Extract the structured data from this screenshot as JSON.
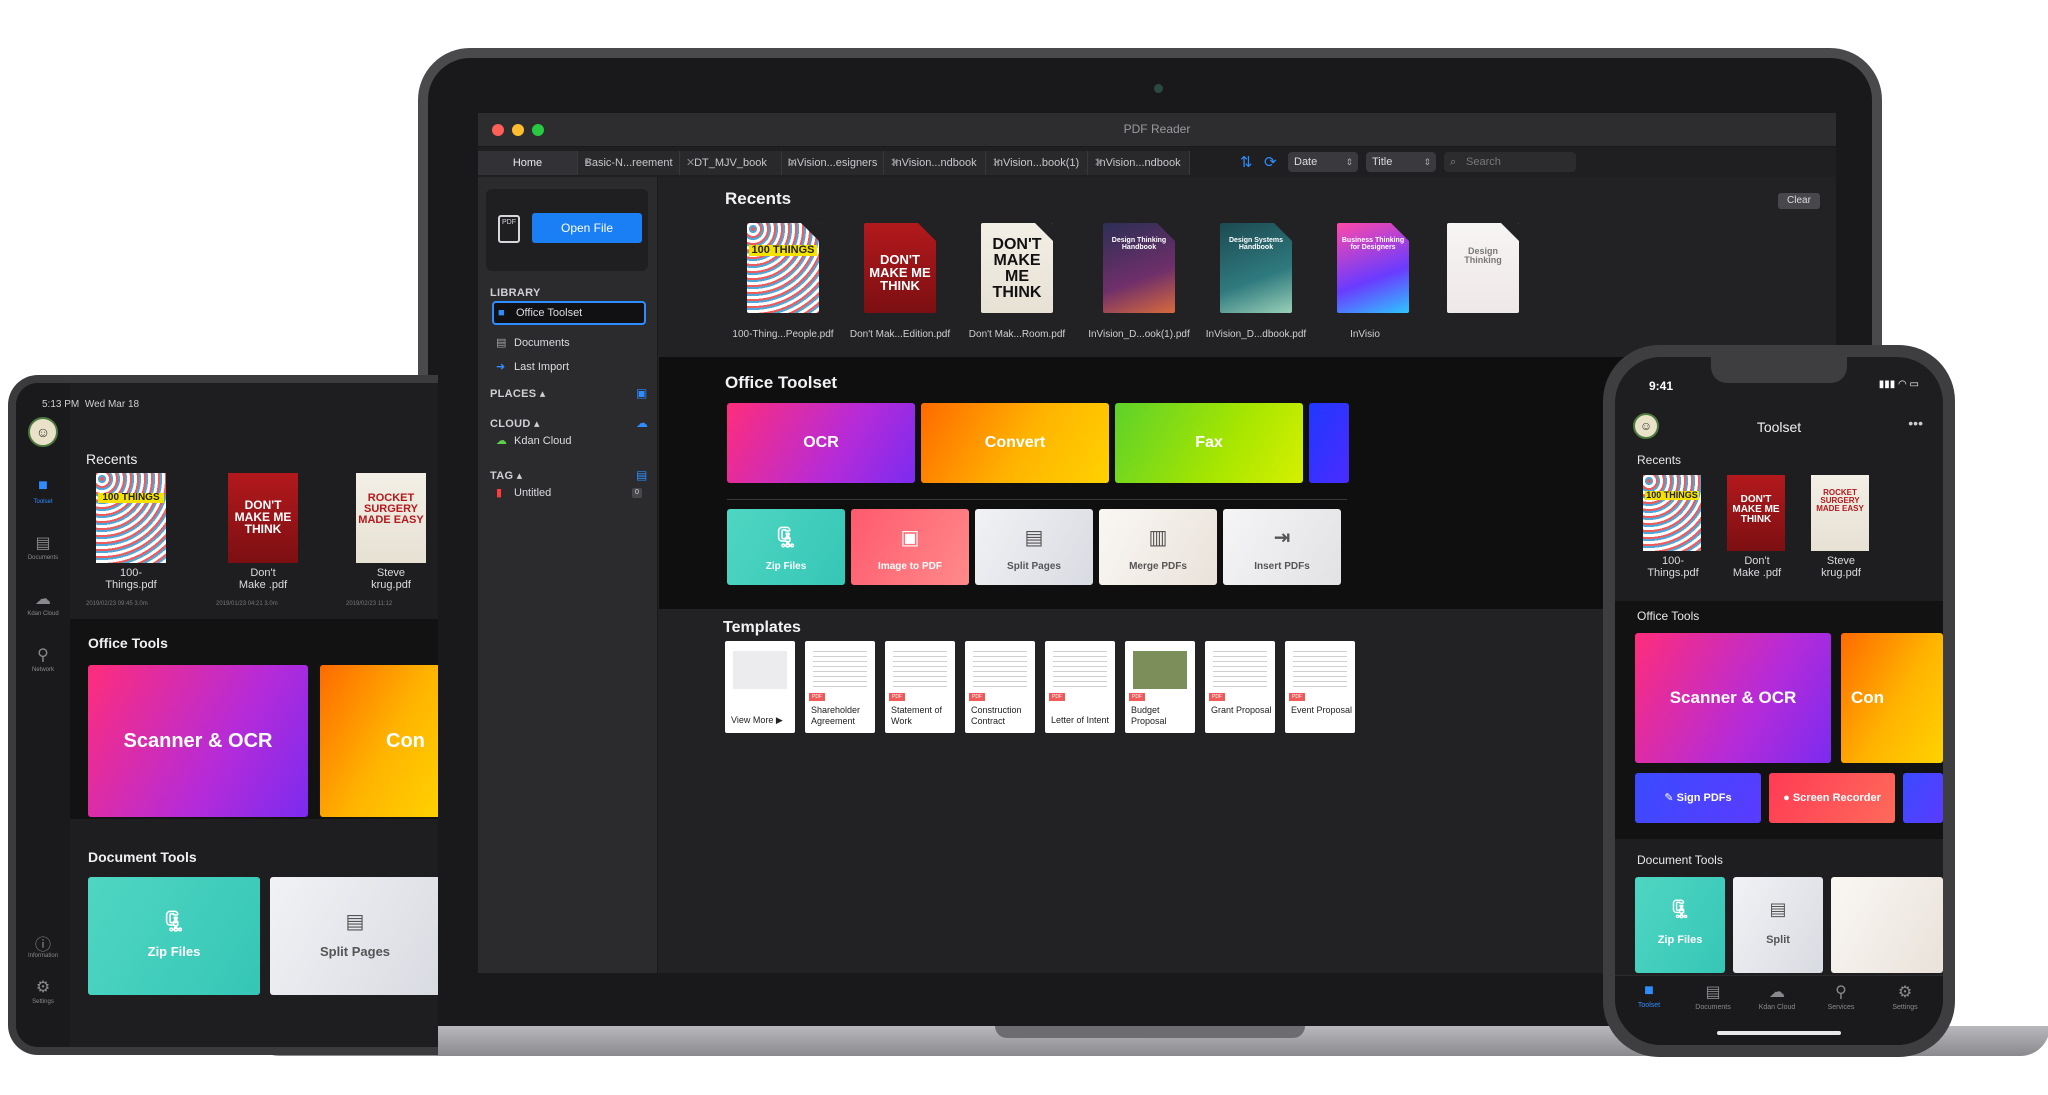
{
  "laptop": {
    "window_title": "PDF Reader",
    "tabs": [
      {
        "label": "Home"
      },
      {
        "label": "Basic-N...reement"
      },
      {
        "label": "DT_MJV_book"
      },
      {
        "label": "InVision...esigners"
      },
      {
        "label": "InVision...ndbook"
      },
      {
        "label": "InVision...book(1)"
      },
      {
        "label": "InVision...ndbook"
      }
    ],
    "toolbar": {
      "sort_select": "Date",
      "sort_select2": "Title",
      "search_placeholder": "Search"
    },
    "sidebar": {
      "open_button": "Open File",
      "library_title": "LIBRARY",
      "library_items": [
        {
          "label": "Office Toolset"
        },
        {
          "label": "Documents"
        },
        {
          "label": "Last Import"
        }
      ],
      "places_title": "PLACES",
      "cloud_title": "CLOUD",
      "cloud_items": [
        {
          "label": "Kdan Cloud"
        }
      ],
      "tag_title": "TAG",
      "tag_items": [
        {
          "label": "Untitled",
          "count": "0"
        }
      ]
    },
    "recents": {
      "title": "Recents",
      "clear_button": "Clear",
      "files": [
        {
          "label": "100-Thing...People.pdf",
          "cover": "100 THINGS"
        },
        {
          "label": "Don't Mak...Edition.pdf",
          "cover": "DON'T MAKE ME THINK"
        },
        {
          "label": "Don't Mak...Room.pdf",
          "cover": "DON'T MAKE ME THINK"
        },
        {
          "label": "InVision_D...ook(1).pdf",
          "cover": "Design Thinking Handbook"
        },
        {
          "label": "InVision_D...dbook.pdf",
          "cover": "Design Systems Handbook"
        },
        {
          "label": "InVisio",
          "cover": "Business Thinking for Designers"
        },
        {
          "label": "",
          "cover": "Design Thinking"
        }
      ]
    },
    "office_toolset": {
      "title": "Office Toolset",
      "big_tools": [
        {
          "label": "OCR"
        },
        {
          "label": "Convert"
        },
        {
          "label": "Fax"
        }
      ],
      "small_tools": [
        {
          "label": "Zip Files"
        },
        {
          "label": "Image to PDF"
        },
        {
          "label": "Split Pages"
        },
        {
          "label": "Merge PDFs"
        },
        {
          "label": "Insert PDFs"
        }
      ]
    },
    "templates": {
      "title": "Templates",
      "items": [
        {
          "label": "View More ▶",
          "badge": ""
        },
        {
          "label": "Shareholder Agreement",
          "badge": "PDF"
        },
        {
          "label": "Statement of Work",
          "badge": "PDF"
        },
        {
          "label": "Construction Contract",
          "badge": "PDF"
        },
        {
          "label": "Letter of Intent",
          "badge": "PDF"
        },
        {
          "label": "Budget Proposal",
          "badge": "PDF"
        },
        {
          "label": "Grant Proposal",
          "badge": "PDF"
        },
        {
          "label": "Event Proposal",
          "badge": "PDF"
        }
      ]
    }
  },
  "tablet": {
    "status_time": "5:13 PM",
    "status_date": "Wed Mar 18",
    "rail": [
      {
        "label": "Toolset"
      },
      {
        "label": "Documents"
      },
      {
        "label": "Kdan Cloud"
      },
      {
        "label": "Network"
      },
      {
        "label": "Information"
      },
      {
        "label": "Settings"
      }
    ],
    "recents_title": "Recents",
    "files": [
      {
        "label": "100-\nThings.pdf",
        "meta": "2019/02/23 09:45",
        "size": "3.0m",
        "cover": "100 THINGS"
      },
      {
        "label": "Don't\nMake .pdf",
        "meta": "2019/01/23 04:21",
        "size": "3.0m",
        "cover": "DON'T MAKE ME THINK"
      },
      {
        "label": "Steve\nkrug.pdf",
        "meta": "2019/02/23 11:12",
        "size": "",
        "cover": "ROCKET SURGERY MADE EASY"
      }
    ],
    "office_title": "Office Tools",
    "office_cards": [
      {
        "label": "Scanner & OCR"
      },
      {
        "label": "Con"
      }
    ],
    "document_title": "Document Tools",
    "document_cards": [
      {
        "label": "Zip Files"
      },
      {
        "label": "Split Pages"
      }
    ]
  },
  "phone": {
    "time": "9:41",
    "title": "Toolset",
    "recents_title": "Recents",
    "files": [
      {
        "label": "100-\nThings.pdf",
        "cover": "100 THINGS"
      },
      {
        "label": "Don't\nMake .pdf",
        "cover": "DON'T MAKE ME THINK"
      },
      {
        "label": "Steve\nkrug.pdf",
        "cover": "ROCKET SURGERY MADE EASY"
      }
    ],
    "office_title": "Office Tools",
    "office_cards": [
      {
        "label": "Scanner & OCR"
      },
      {
        "label": "Con"
      }
    ],
    "office_small": [
      {
        "label": "Sign PDFs"
      },
      {
        "label": "Screen Recorder"
      }
    ],
    "document_title": "Document Tools",
    "document_cards": [
      {
        "label": "Zip Files"
      },
      {
        "label": "Split"
      }
    ],
    "tabbar": [
      {
        "label": "Toolset"
      },
      {
        "label": "Documents"
      },
      {
        "label": "Kdan Cloud"
      },
      {
        "label": "Services"
      },
      {
        "label": "Settings"
      }
    ]
  }
}
